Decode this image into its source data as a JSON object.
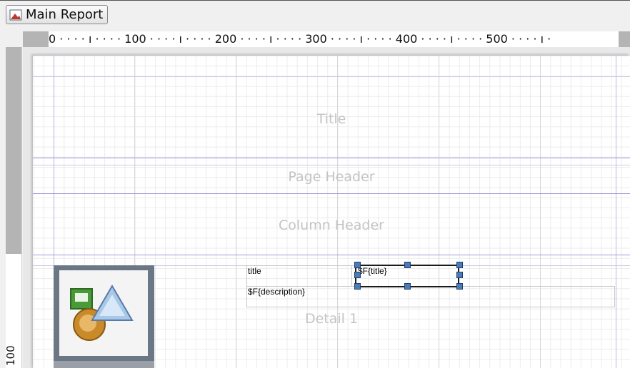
{
  "tab": {
    "label": "Main Report",
    "icon": "report-icon"
  },
  "ruler": {
    "horizontal": "0 · · · · ı · · · · 100 · · · · ı · · · · 200 · · · · ı · · · · 300 · · · · ı · · · · 400 · · · · ı · · · · 500 · · · · ı ·",
    "vertical_label": "100"
  },
  "bands": {
    "title": "Title",
    "page_header": "Page Header",
    "column_header": "Column Header",
    "detail": "Detail 1"
  },
  "elements": {
    "static_title": "title",
    "field_title": "$F{title}",
    "field_description": "$F{description}",
    "image_icon": "image-element-icon"
  },
  "colors": {
    "band_line": "#9a9ad6",
    "handle": "#4a7ab8",
    "band_label": "#c4c4c4"
  }
}
